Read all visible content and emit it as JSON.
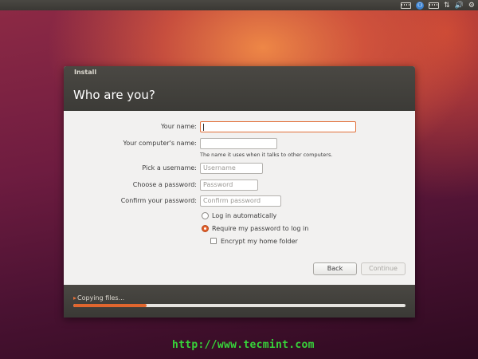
{
  "window": {
    "title": "Install",
    "heading": "Who are you?"
  },
  "form": {
    "your_name": {
      "label": "Your name:",
      "value": "",
      "placeholder": ""
    },
    "computer_name": {
      "label": "Your computer's name:",
      "value": "",
      "placeholder": "",
      "hint": "The name it uses when it talks to other computers."
    },
    "username": {
      "label": "Pick a username:",
      "value": "",
      "placeholder": "Username"
    },
    "password": {
      "label": "Choose a password:",
      "value": "",
      "placeholder": "Password"
    },
    "confirm_password": {
      "label": "Confirm your password:",
      "value": "",
      "placeholder": "Confirm password"
    },
    "login_options": [
      {
        "label": "Log in automatically",
        "selected": false
      },
      {
        "label": "Require my password to log in",
        "selected": true
      }
    ],
    "encrypt_home": {
      "label": "Encrypt my home folder",
      "checked": false
    }
  },
  "buttons": {
    "back": "Back",
    "continue": "Continue"
  },
  "progress": {
    "label": "Copying files...",
    "percent": 22
  },
  "tray": {
    "icons": [
      "keyboard-icon",
      "accessibility-icon",
      "keyboard-layout-icon",
      "network-icon",
      "volume-icon",
      "settings-gear-icon"
    ]
  },
  "watermark": "http://www.tecmint.com",
  "colors": {
    "accent": "#e25f2c",
    "panel": "#3c3b37",
    "watermark": "#37d43a"
  }
}
